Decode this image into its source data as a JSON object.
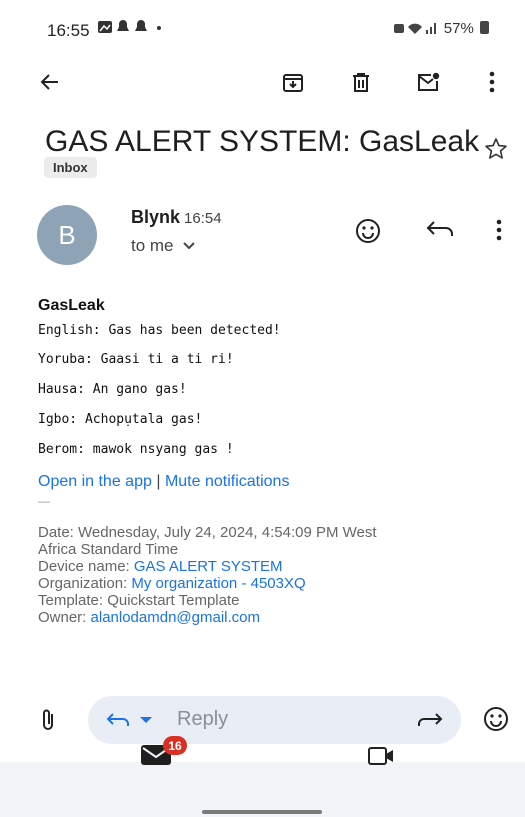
{
  "status_bar": {
    "time": "16:55",
    "battery": "57%"
  },
  "email": {
    "subject": "GAS ALERT SYSTEM: GasLeak",
    "label": "Inbox",
    "sender": {
      "initial": "B",
      "name": "Blynk",
      "time": "16:54",
      "to": "to me"
    },
    "body": {
      "title": "GasLeak",
      "lines": [
        "English: Gas has been detected!",
        "Yoruba: Gaasi ti a ti ri!",
        "Hausa: An gano gas!",
        "Igbo: Achopụtala gas!",
        "Berom: mawok nsyang gas !"
      ],
      "link_open": "Open in the app",
      "link_sep": "|",
      "link_mute": "Mute notifications",
      "divider": "—",
      "meta": {
        "date_label": "Date: Wednesday, July 24, 2024, 4:54:09 PM West",
        "date_cont": "Africa Standard Time",
        "device_label": "Device name: ",
        "device_value": "GAS ALERT SYSTEM",
        "org_label": "Organization: ",
        "org_value": "My organization - 4503XQ",
        "template": "Template: Quickstart Template",
        "owner_label": "Owner: ",
        "owner_value": "alanlodamdn@gmail.com"
      }
    }
  },
  "reply_bar": {
    "reply_label": "Reply"
  },
  "bottom_nav": {
    "mail_badge": "16"
  },
  "colors": {
    "accent": "#1a73e8",
    "badge": "#d93025",
    "avatar": "#8fa3b7"
  }
}
